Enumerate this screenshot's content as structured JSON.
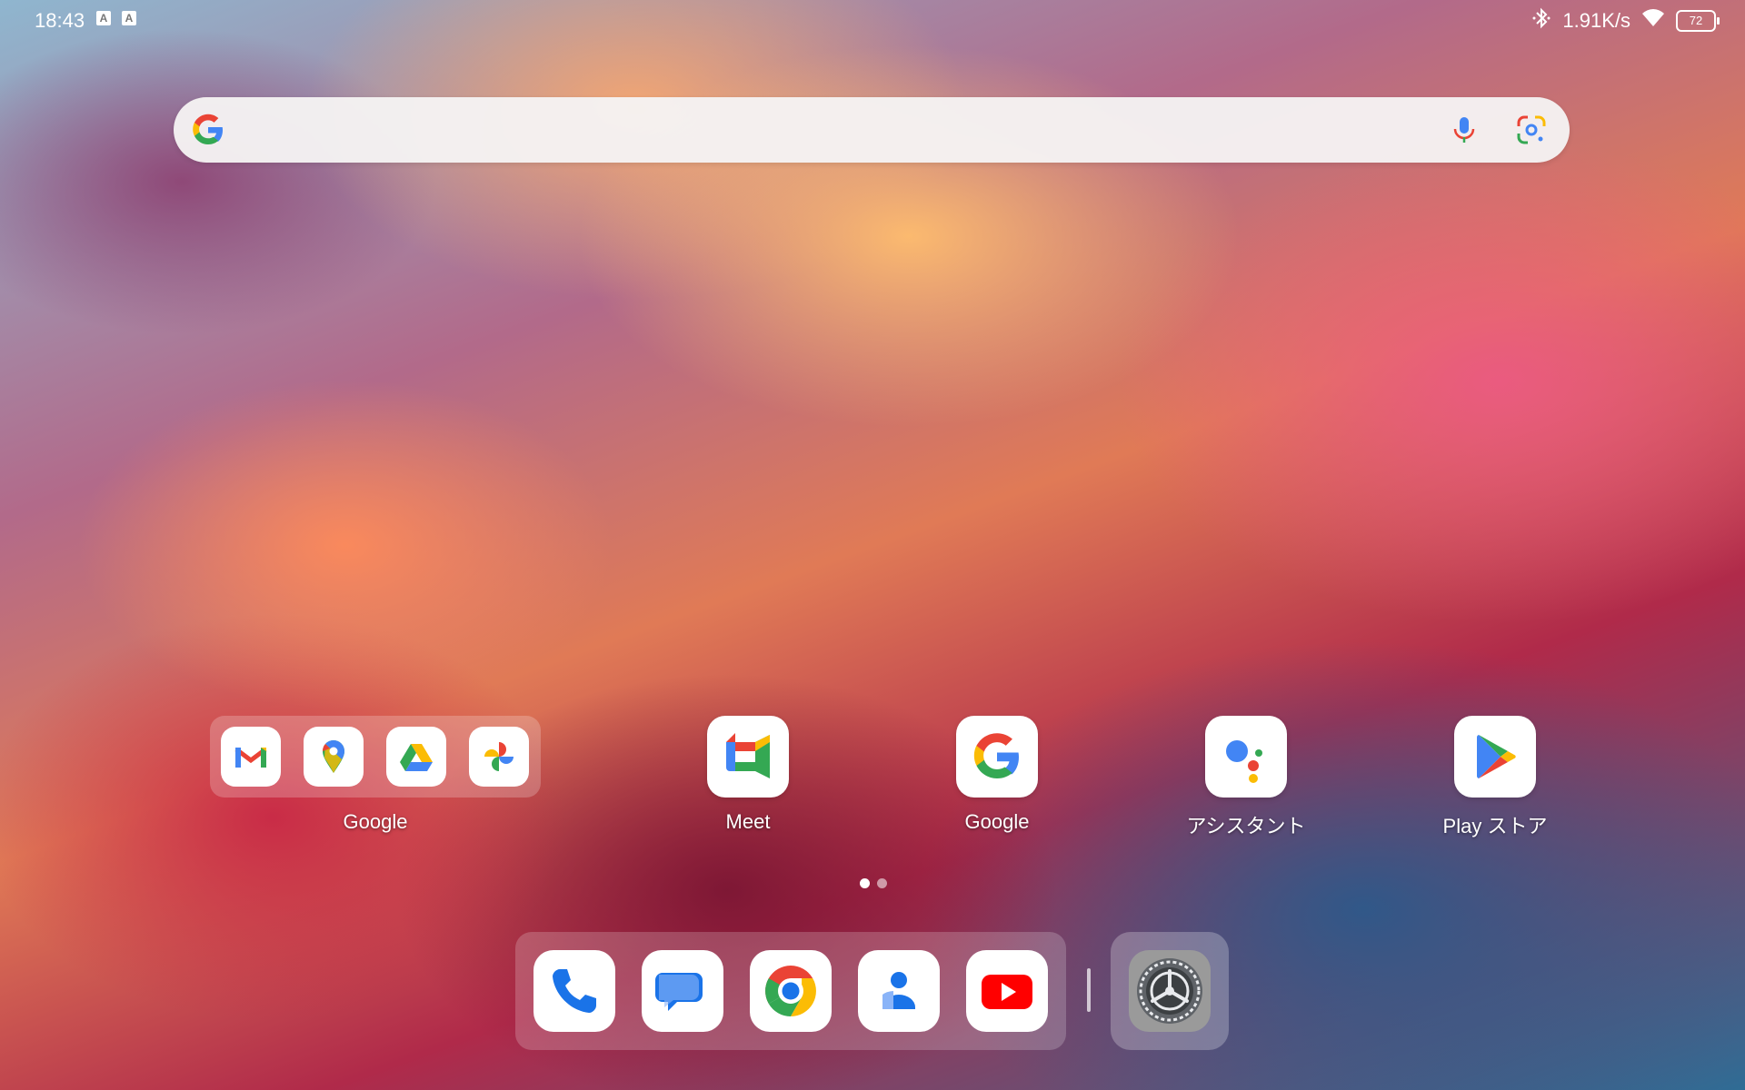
{
  "status_bar": {
    "time": "18:43",
    "notif_icon_1": "A",
    "notif_icon_2": "A",
    "network_speed": "1.91K/s",
    "battery_level": "72",
    "icons": [
      "bluetooth-icon",
      "wifi-icon",
      "battery-icon"
    ]
  },
  "search": {
    "icons": [
      "google-g-icon",
      "mic-icon",
      "lens-icon"
    ]
  },
  "home_apps": [
    {
      "label": "Google",
      "type": "folder",
      "icons": [
        "gmail-icon",
        "maps-icon",
        "drive-icon",
        "photos-icon"
      ]
    },
    {
      "label": "Meet",
      "icon": "meet-icon"
    },
    {
      "label": "Google",
      "icon": "google-icon"
    },
    {
      "label": "アシスタント",
      "icon": "assistant-icon"
    },
    {
      "label": "Play ストア",
      "icon": "play-store-icon"
    }
  ],
  "page_indicator": {
    "current": 1,
    "total": 2
  },
  "dock": {
    "apps": [
      "phone-icon",
      "messages-icon",
      "chrome-icon",
      "contacts-icon",
      "youtube-icon"
    ],
    "pinned": "settings-icon"
  },
  "colors": {
    "google_blue": "#4285F4",
    "google_red": "#EA4335",
    "google_yellow": "#FBBC05",
    "google_green": "#34A853"
  }
}
